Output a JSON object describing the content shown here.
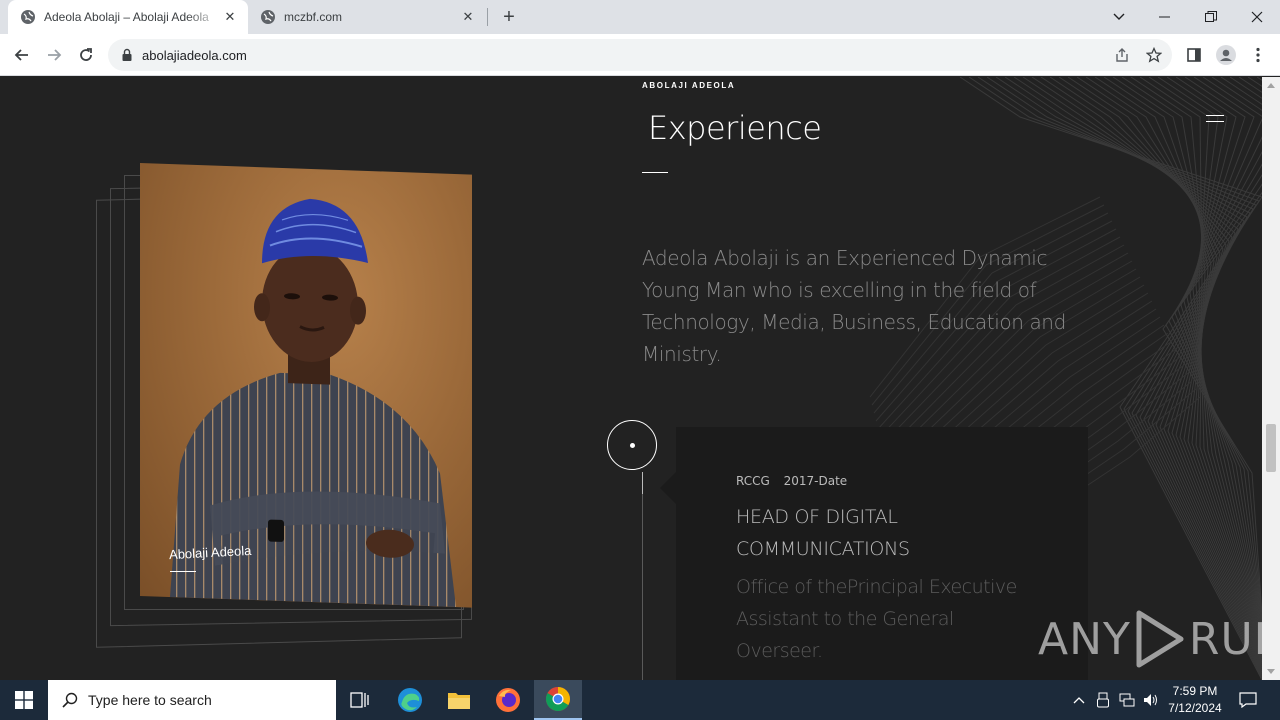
{
  "browser": {
    "tabs": [
      {
        "title": "Adeola Abolaji – Abolaji Adeola",
        "active": true
      },
      {
        "title": "mczbf.com",
        "active": false
      }
    ],
    "url": "abolajiadeola.com"
  },
  "page": {
    "brand": "ABOLAJI ADEOLA",
    "section_title": "Experience",
    "intro": "Adeola Abolaji is an Experienced Dynamic Young Man who is excelling in the field of Technology, Media, Business, Education and Ministry.",
    "photo_caption": "Abolaji Adeola",
    "experience": [
      {
        "org": "RCCG",
        "period": "2017-Date",
        "role": "HEAD OF DIGITAL COMMUNICATIONS",
        "description": "Office of thePrincipal Executive Assistant to the General Overseer."
      }
    ],
    "watermark_left": "ANY",
    "watermark_right": "RUN"
  },
  "taskbar": {
    "search_placeholder": "Type here to search",
    "time": "7:59 PM",
    "date": "7/12/2024"
  },
  "colors": {
    "page_bg": "#222222",
    "card_bg": "#1b1b1b",
    "accent_text": "#ffffff",
    "taskbar_bg": "#1c2a3a"
  }
}
